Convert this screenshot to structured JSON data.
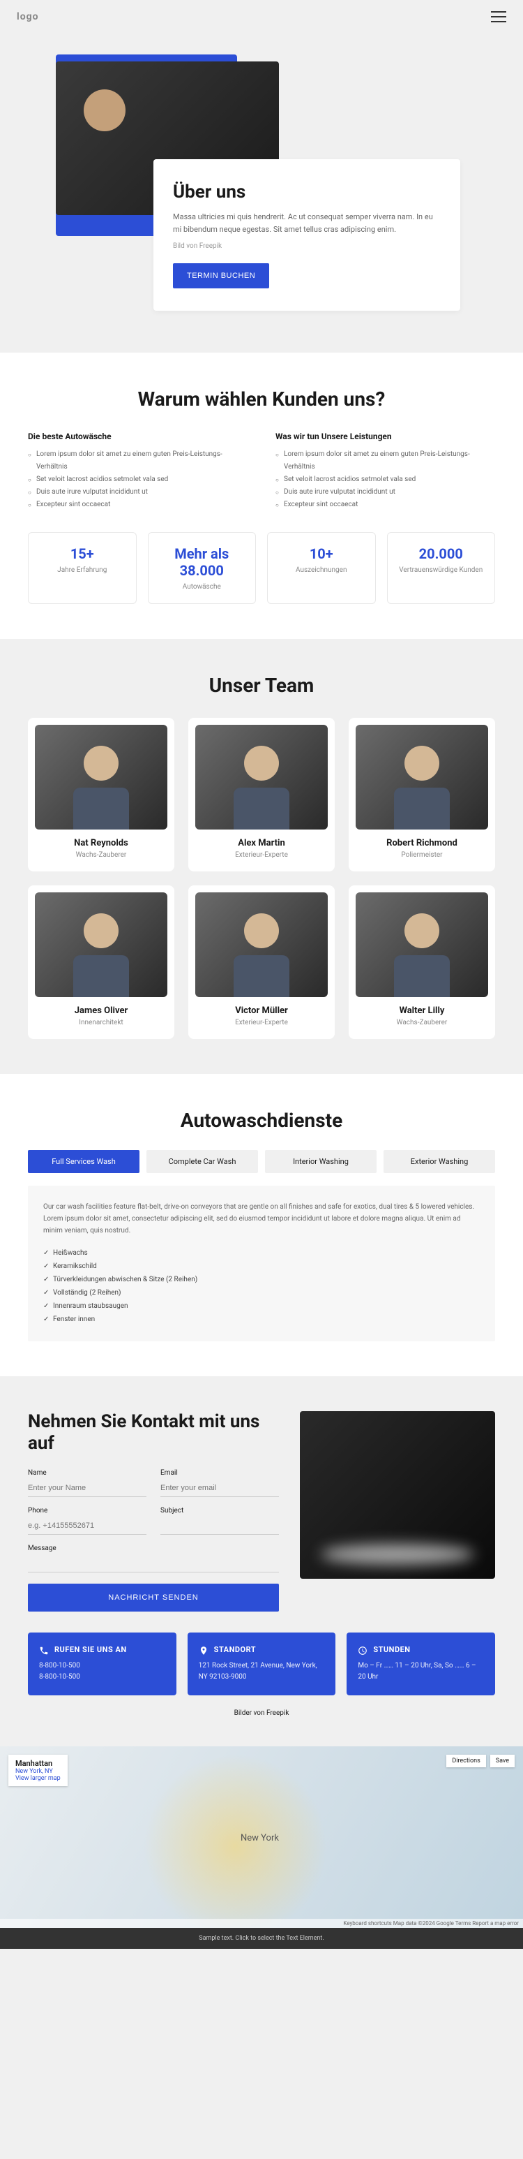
{
  "header": {
    "logo": "logo"
  },
  "hero": {
    "title": "Über uns",
    "desc": "Massa ultricies mi quis hendrerit. Ac ut consequat semper viverra nam. In eu mi bibendum neque egestas. Sit amet tellus cras adipiscing enim.",
    "credit": "Bild von Freepik",
    "cta": "TERMIN BUCHEN"
  },
  "why": {
    "title": "Warum wählen Kunden uns?",
    "col1": {
      "heading": "Die beste Autowäsche",
      "items": [
        "Lorem ipsum dolor sit amet zu einem guten Preis-Leistungs-Verhältnis",
        "Set veloit lacrost acidios setmolet vala sed",
        "Duis aute irure vulputat incididunt ut",
        "Excepteur sint occaecat"
      ]
    },
    "col2": {
      "heading": "Was wir tun Unsere Leistungen",
      "items": [
        "Lorem ipsum dolor sit amet zu einem guten Preis-Leistungs-Verhältnis",
        "Set veloit lacrost acidios setmolet vala sed",
        "Duis aute irure vulputat incididunt ut",
        "Excepteur sint occaecat"
      ]
    },
    "stats": [
      {
        "value": "15+",
        "label": "Jahre Erfahrung"
      },
      {
        "value": "Mehr als 38.000",
        "label": "Autowäsche"
      },
      {
        "value": "10+",
        "label": "Auszeichnungen"
      },
      {
        "value": "20.000",
        "label": "Vertrauenswürdige Kunden"
      }
    ]
  },
  "team": {
    "title": "Unser Team",
    "members": [
      {
        "name": "Nat Reynolds",
        "role": "Wachs-Zauberer"
      },
      {
        "name": "Alex Martin",
        "role": "Exterieur-Experte"
      },
      {
        "name": "Robert Richmond",
        "role": "Poliermeister"
      },
      {
        "name": "James Oliver",
        "role": "Innenarchitekt"
      },
      {
        "name": "Victor Müller",
        "role": "Exterieur-Experte"
      },
      {
        "name": "Walter Lilly",
        "role": "Wachs-Zauberer"
      }
    ]
  },
  "services": {
    "title": "Autowaschdienste",
    "tabs": [
      "Full Services Wash",
      "Complete Car Wash",
      "Interior Washing",
      "Exterior Washing"
    ],
    "desc": "Our car wash facilities feature flat-belt, drive-on conveyors that are gentle on all finishes and safe for exotics, dual tires & 5 lowered vehicles. Lorem ipsum dolor sit amet, consectetur adipiscing elit, sed do eiusmod tempor incididunt ut labore et dolore magna aliqua. Ut enim ad minim veniam, quis nostrud.",
    "features": [
      "Heißwachs",
      "Keramikschild",
      "Türverkleidungen abwischen & Sitze (2 Reihen)",
      "Vollständig (2 Reihen)",
      "Innenraum staubsaugen",
      "Fenster innen"
    ]
  },
  "contact": {
    "title": "Nehmen Sie Kontakt mit uns auf",
    "fields": {
      "name": {
        "label": "Name",
        "placeholder": "Enter your Name"
      },
      "email": {
        "label": "Email",
        "placeholder": "Enter your email"
      },
      "phone": {
        "label": "Phone",
        "placeholder": "e.g. +14155552671"
      },
      "subject": {
        "label": "Subject",
        "placeholder": ""
      },
      "message": {
        "label": "Message",
        "placeholder": ""
      }
    },
    "submit": "NACHRICHT SENDEN"
  },
  "info": [
    {
      "icon": "phone",
      "title": "RUFEN SIE UNS AN",
      "lines": [
        "8-800-10-500",
        "8-800-10-500"
      ]
    },
    {
      "icon": "pin",
      "title": "STANDORT",
      "lines": [
        "121 Rock Street, 21 Avenue, New York,",
        "NY 92103-9000"
      ]
    },
    {
      "icon": "clock",
      "title": "STUNDEN",
      "lines": [
        "Mo – Fr …… 11 – 20 Uhr, Sa, So …… 6 –",
        "20 Uhr"
      ]
    }
  ],
  "credit_bottom": "Bilder von Freepik",
  "map": {
    "place": "Manhattan",
    "place_sub": "New York, NY",
    "link": "View larger map",
    "buttons": [
      "Directions",
      "Save"
    ],
    "city": "New York",
    "attrib": "Keyboard shortcuts   Map data ©2024 Google   Terms   Report a map error"
  },
  "footer_sel": "Sample text. Click to select the Text Element."
}
